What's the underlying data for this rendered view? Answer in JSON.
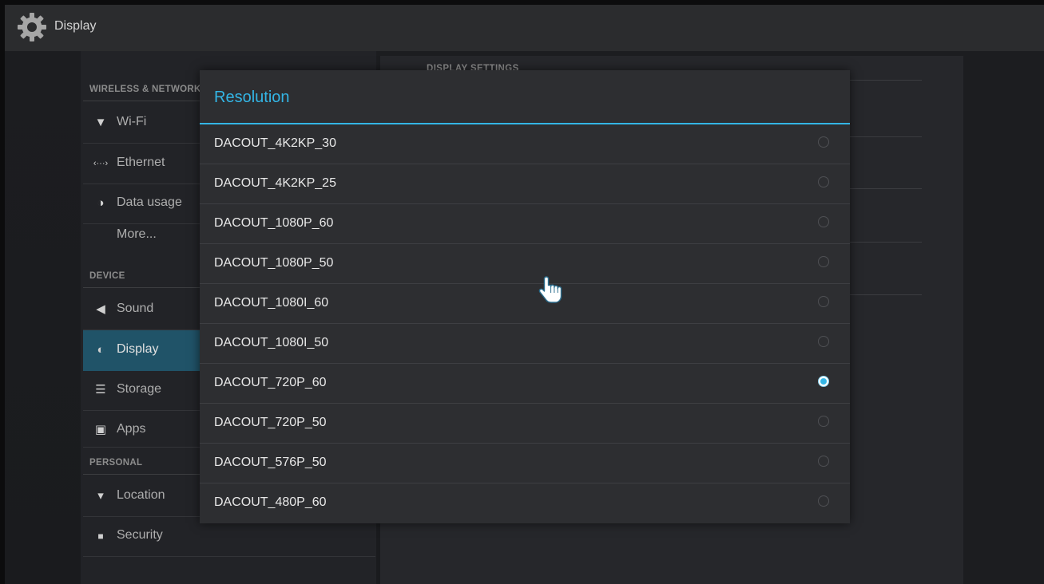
{
  "actionbar": {
    "title": "Display",
    "icon": "gear-icon"
  },
  "sidebar": {
    "categories": [
      "WIRELESS & NETWORKS",
      "DEVICE",
      "PERSONAL"
    ],
    "items": [
      {
        "label": "Wi-Fi",
        "icon": "wifi-icon",
        "glyph": "▼"
      },
      {
        "label": "Ethernet",
        "icon": "ethernet-icon",
        "glyph": "‹···›"
      },
      {
        "label": "Data usage",
        "icon": "data-usage-icon",
        "glyph": "◑"
      },
      {
        "label": "More...",
        "icon": "",
        "glyph": ""
      },
      {
        "label": "Sound",
        "icon": "speaker-icon",
        "glyph": "◀"
      },
      {
        "label": "Display",
        "icon": "brightness-icon",
        "glyph": "◐"
      },
      {
        "label": "Storage",
        "icon": "storage-icon",
        "glyph": "☰"
      },
      {
        "label": "Apps",
        "icon": "apps-icon",
        "glyph": "▣"
      },
      {
        "label": "Location",
        "icon": "location-pin-icon",
        "glyph": "▾"
      },
      {
        "label": "Security",
        "icon": "lock-icon",
        "glyph": "■"
      }
    ],
    "selected": "Display"
  },
  "right_pane": {
    "header": "DISPLAY SETTINGS"
  },
  "dialog": {
    "title": "Resolution",
    "options": [
      {
        "label": "DACOUT_4K2KP_30",
        "checked": false
      },
      {
        "label": "DACOUT_4K2KP_25",
        "checked": false
      },
      {
        "label": "DACOUT_1080P_60",
        "checked": false
      },
      {
        "label": "DACOUT_1080P_50",
        "checked": false
      },
      {
        "label": "DACOUT_1080I_60",
        "checked": false
      },
      {
        "label": "DACOUT_1080I_50",
        "checked": false
      },
      {
        "label": "DACOUT_720P_60",
        "checked": true
      },
      {
        "label": "DACOUT_720P_50",
        "checked": false
      },
      {
        "label": "DACOUT_576P_50",
        "checked": false
      },
      {
        "label": "DACOUT_480P_60",
        "checked": false
      }
    ]
  },
  "colors": {
    "accent": "#33b5e5",
    "selected_bg": "#205368"
  }
}
